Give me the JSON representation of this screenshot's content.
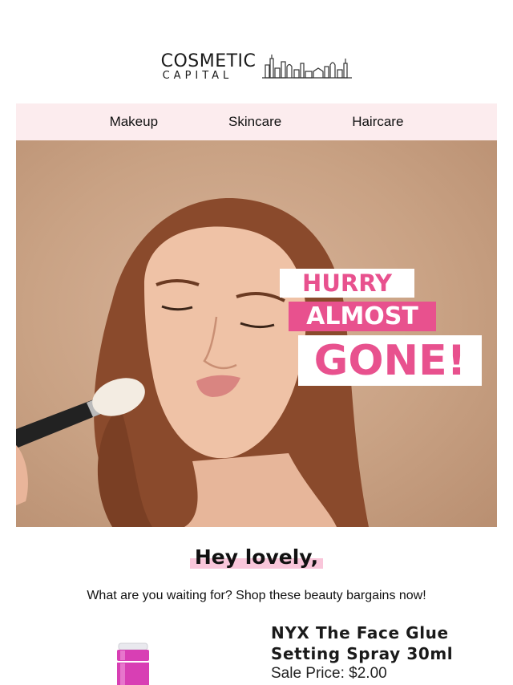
{
  "brand": {
    "line1": "COSMETIC",
    "line2": "CAPITAL",
    "skyline_icon": "city-skyline-icon"
  },
  "nav": {
    "items": [
      {
        "label": "Makeup"
      },
      {
        "label": "Skincare"
      },
      {
        "label": "Haircare"
      }
    ],
    "background": "#fcecee"
  },
  "hero": {
    "line1": "HURRY",
    "line2": "ALMOST",
    "line3": "GONE!",
    "accent": "#e8518e"
  },
  "greeting": "Hey lovely,",
  "subtitle": "What are you waiting for? Shop these beauty bargains now!",
  "product": {
    "title": "NYX The Face Glue Setting Spray 30ml",
    "price": "Sale Price: $2.00",
    "image_icon": "setting-spray-bottle-icon"
  }
}
